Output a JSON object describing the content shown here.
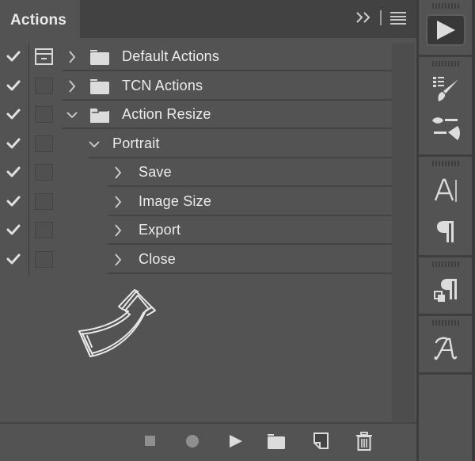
{
  "panel": {
    "tab_label": "Actions",
    "collapse_icon": "double-chevron-right-icon",
    "menu_icon": "hamburger-menu-icon"
  },
  "actions": [
    {
      "label": "Default Actions",
      "level": 0,
      "type": "set",
      "expanded": false,
      "checked": true,
      "dialog": true
    },
    {
      "label": "TCN Actions",
      "level": 0,
      "type": "set",
      "expanded": false,
      "checked": true,
      "dialog": false
    },
    {
      "label": "Action Resize",
      "level": 0,
      "type": "set",
      "expanded": true,
      "checked": true,
      "dialog": false
    },
    {
      "label": "Portrait",
      "level": 1,
      "type": "action",
      "expanded": true,
      "checked": true,
      "dialog": false
    },
    {
      "label": "Save",
      "level": 2,
      "type": "command",
      "expanded": false,
      "checked": true,
      "dialog": false
    },
    {
      "label": "Image Size",
      "level": 2,
      "type": "command",
      "expanded": false,
      "checked": true,
      "dialog": false
    },
    {
      "label": "Export",
      "level": 2,
      "type": "command",
      "expanded": false,
      "checked": true,
      "dialog": false
    },
    {
      "label": "Close",
      "level": 2,
      "type": "command",
      "expanded": false,
      "checked": true,
      "dialog": false
    }
  ],
  "toolbar": {
    "buttons": [
      "stop-recording",
      "begin-recording",
      "play-selection",
      "create-new-set",
      "create-new-action",
      "delete"
    ]
  },
  "dock": {
    "icons": [
      "actions-panel",
      "brush-presets",
      "brush-settings",
      "character",
      "paragraph",
      "paragraph-styles",
      "glyphs"
    ]
  },
  "colors": {
    "panel_bg": "#535353",
    "tabbar_bg": "#424242",
    "text": "#ececec",
    "icon": "#d8d8d8",
    "disabled_icon": "#8f8f8f"
  }
}
